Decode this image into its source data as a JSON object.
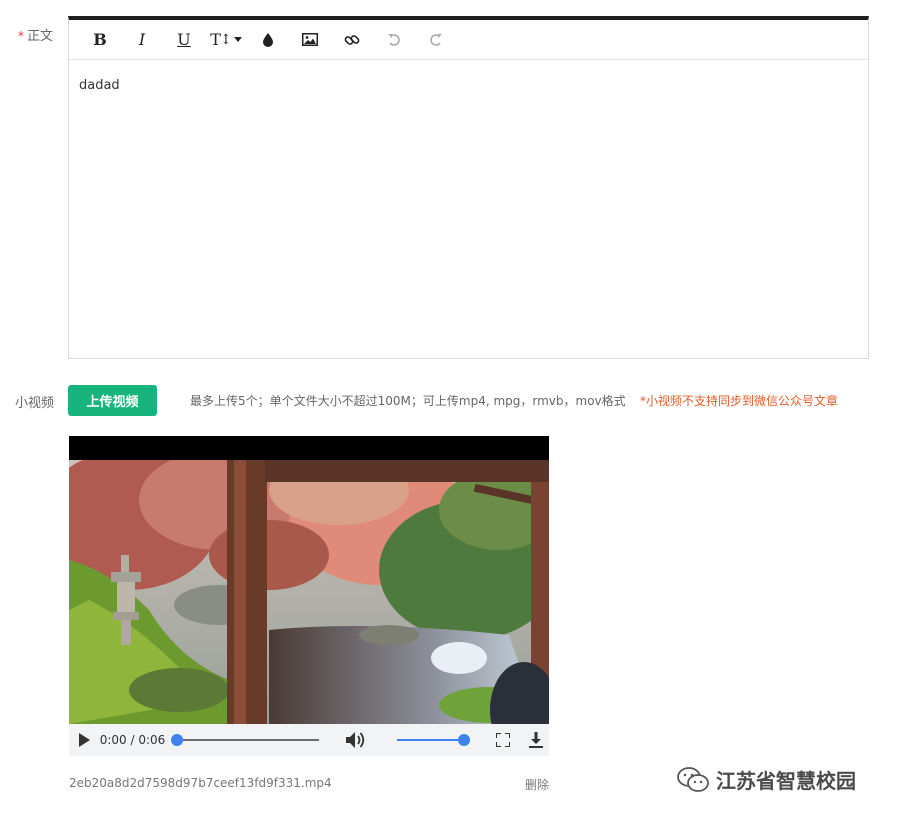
{
  "body_field": {
    "required_mark": "*",
    "label": "正文"
  },
  "editor": {
    "toolbar": [
      {
        "name": "bold-button",
        "icon": "B"
      },
      {
        "name": "italic-button",
        "icon": "I"
      },
      {
        "name": "underline-button",
        "icon": "U"
      },
      {
        "name": "font-size-button",
        "icon": "TI"
      }
    ],
    "content": "dadad"
  },
  "video_field": {
    "label": "小视频",
    "upload_button": "上传视频",
    "hint": "最多上传5个；单个文件大小不超过100M；可上传mp4, mpg，rmvb，mov格式",
    "warning": "*小视频不支持同步到微信公众号文章"
  },
  "player": {
    "current_time": "0:00",
    "separator": "/",
    "duration": "0:06",
    "progress": 0.0,
    "volume": 1.0
  },
  "file": {
    "name": "2eb20a8d2d7598d97b7ceef13fd9f331.mp4",
    "delete_label": "删除"
  },
  "watermark": {
    "text": "江苏省智慧校园"
  },
  "colors": {
    "accent": "#18b47d",
    "warning": "#e05c2a",
    "slider": "#3f82f0"
  }
}
